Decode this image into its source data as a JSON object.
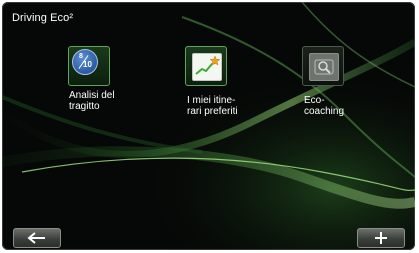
{
  "header": {
    "title": "Driving Eco²"
  },
  "menu": {
    "items": [
      {
        "label": "Analisi del\ntragitto",
        "icon": "score-badge-icon",
        "badge_top": "8",
        "badge_bottom": "10",
        "state": "active"
      },
      {
        "label": "I miei itine-\nrari preferiti",
        "icon": "chart-star-icon",
        "state": "active"
      },
      {
        "label": "Eco-\ncoaching",
        "icon": "magnifier-icon",
        "state": "disabled"
      }
    ]
  },
  "footer": {
    "back_icon": "back-arrow-icon",
    "plus_icon": "plus-icon"
  },
  "colors": {
    "accent_green": "#5fa35a",
    "badge_blue": "#2c5aa3",
    "background": "#060807"
  }
}
